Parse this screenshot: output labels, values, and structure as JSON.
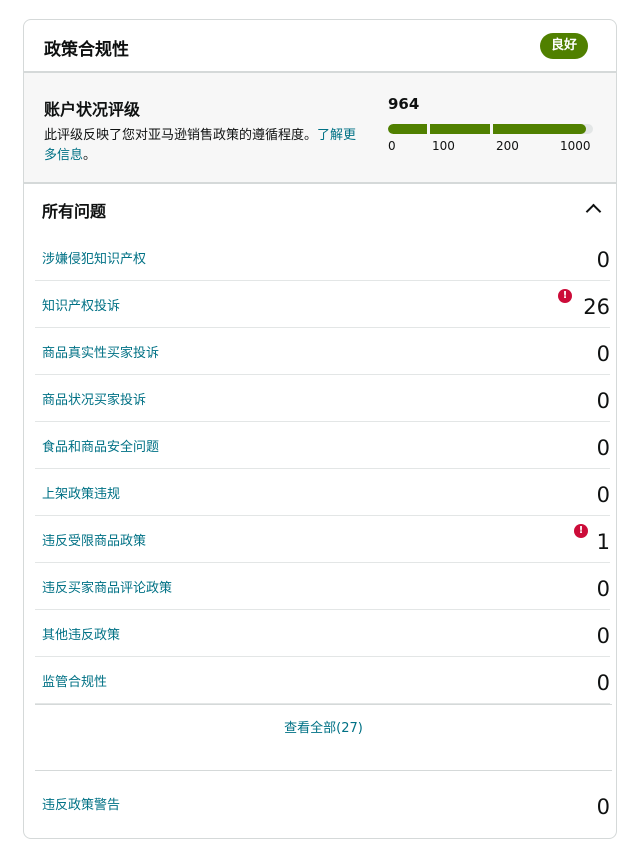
{
  "header": {
    "title": "政策合规性",
    "badge": "良好"
  },
  "rating": {
    "title": "账户状况评级",
    "desc_prefix": "此评级反映了您对亚马逊销售政策的遵循程度。",
    "desc_link": "了解更多信息",
    "desc_suffix": "。",
    "score": "964",
    "score_value": 964,
    "scale_max": 1000,
    "ticks": [
      "0",
      "100",
      "200",
      "1000"
    ]
  },
  "issues": {
    "title": "所有问题",
    "items": [
      {
        "label": "涉嫌侵犯知识产权",
        "count": "0",
        "alert": false
      },
      {
        "label": "知识产权投诉",
        "count": "26",
        "alert": true
      },
      {
        "label": "商品真实性买家投诉",
        "count": "0",
        "alert": false
      },
      {
        "label": "商品状况买家投诉",
        "count": "0",
        "alert": false
      },
      {
        "label": "食品和商品安全问题",
        "count": "0",
        "alert": false
      },
      {
        "label": "上架政策违规",
        "count": "0",
        "alert": false
      },
      {
        "label": "违反受限商品政策",
        "count": "1",
        "alert": true
      },
      {
        "label": "违反买家商品评论政策",
        "count": "0",
        "alert": false
      },
      {
        "label": "其他违反政策",
        "count": "0",
        "alert": false
      },
      {
        "label": "监管合规性",
        "count": "0",
        "alert": false
      }
    ],
    "view_all": "查看全部(27)"
  },
  "warnings": {
    "label": "违反政策警告",
    "count": "0"
  },
  "colors": {
    "accent": "#508000",
    "link": "#007185",
    "alert": "#cc0c39"
  }
}
